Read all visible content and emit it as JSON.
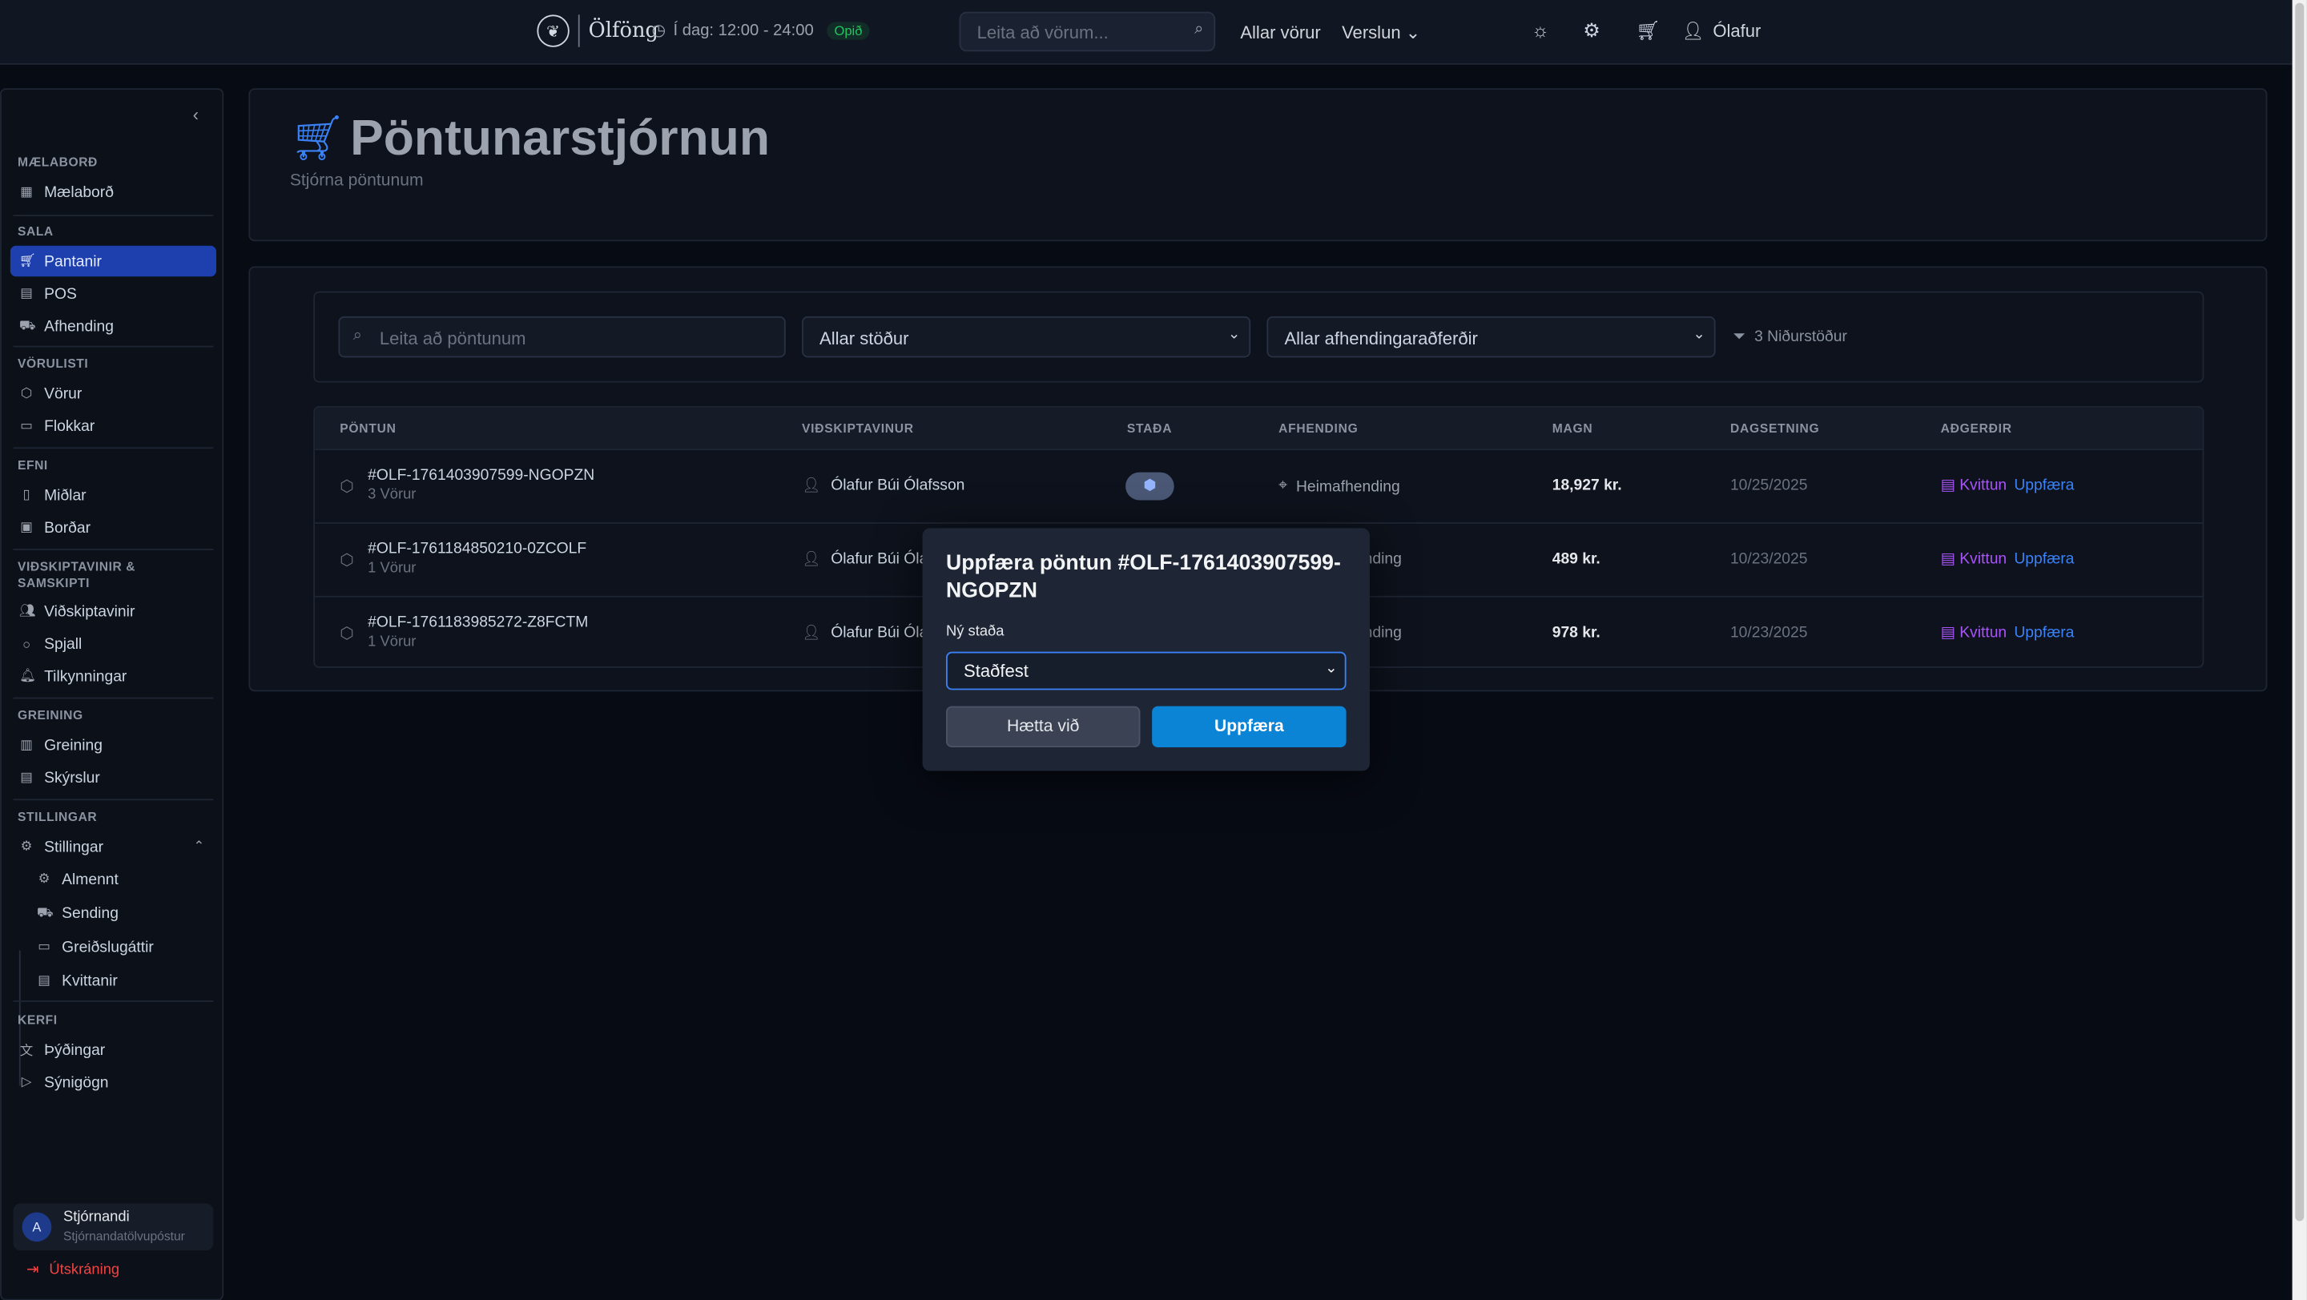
{
  "header": {
    "brand": "Ölföng",
    "hours": "Í dag: 12:00 - 24:00",
    "open_status": "Opið",
    "search_placeholder": "Leita að vörum...",
    "nav": {
      "all_products": "Allar vörur",
      "store": "Verslun"
    },
    "user_name": "Ólafur"
  },
  "sidebar": {
    "sections": {
      "dashboard": "MÆLABORÐ",
      "sales": "SALA",
      "catalog": "VÖRULISTI",
      "content": "EFNI",
      "customers": "VIÐSKIPTAVINIR & SAMSKIPTI",
      "analytics": "GREINING",
      "settings": "STILLINGAR",
      "system": "KERFI"
    },
    "items": {
      "dashboard": "Mælaborð",
      "orders": "Pantanir",
      "pos": "POS",
      "delivery": "Afhending",
      "products": "Vörur",
      "categories": "Flokkar",
      "media": "Miðlar",
      "banners": "Borðar",
      "customers": "Viðskiptavinir",
      "chat": "Spjall",
      "notifications": "Tilkynningar",
      "analytics": "Greining",
      "reports": "Skýrslur",
      "settings": "Stillingar",
      "general": "Almennt",
      "shipping": "Sending",
      "payments": "Greiðslugáttir",
      "receipts": "Kvittanir",
      "translations": "Þýðingar",
      "demo": "Sýnigögn"
    },
    "admin": {
      "initial": "A",
      "name": "Stjórnandi",
      "email": "Stjórnandatölvupóstur"
    },
    "logout": "Útskráning"
  },
  "page": {
    "title": "Pöntunarstjórnun",
    "subtitle": "Stjórna pöntunum"
  },
  "filters": {
    "search_placeholder": "Leita að pöntunum",
    "status_select": "Allar stöður",
    "delivery_select": "Allar afhendingaraðferðir",
    "results": "3 Niðurstöður"
  },
  "table": {
    "headers": {
      "order": "PÖNTUN",
      "customer": "VIÐSKIPTAVINUR",
      "status": "STAÐA",
      "delivery": "AFHENDING",
      "amount": "MAGN",
      "date": "DAGSETNING",
      "actions": "AÐGERÐIR"
    },
    "rows": [
      {
        "order_no": "#OLF-1761403907599-NGOPZN",
        "items": "3 Vörur",
        "customer": "Ólafur Búi Ólafsson",
        "delivery": "Heimafhending",
        "amount": "18,927 kr.",
        "date": "10/25/2025",
        "receipt": "Kvittun",
        "update": "Uppfæra"
      },
      {
        "order_no": "#OLF-1761184850210-0ZCOLF",
        "items": "1 Vörur",
        "customer": "Ólafur Búi Óla",
        "delivery": "nding",
        "amount": "489 kr.",
        "date": "10/23/2025",
        "receipt": "Kvittun",
        "update": "Uppfæra"
      },
      {
        "order_no": "#OLF-1761183985272-Z8FCTM",
        "items": "1 Vörur",
        "customer": "Ólafur Búi Óla",
        "delivery": "nding",
        "amount": "978 kr.",
        "date": "10/23/2025",
        "receipt": "Kvittun",
        "update": "Uppfæra"
      }
    ]
  },
  "modal": {
    "title": "Uppfæra pöntun #OLF-1761403907599-NGOPZN",
    "label": "Ný staða",
    "selected_status": "Staðfest",
    "cancel": "Hætta við",
    "confirm": "Uppfæra"
  },
  "colors": {
    "accent": "#0b84d6",
    "active_nav": "#1e40af",
    "receipt_link": "#a855f7",
    "update_link": "#3b82f6",
    "open_badge": "#22c55e",
    "logout": "#ef4444"
  }
}
